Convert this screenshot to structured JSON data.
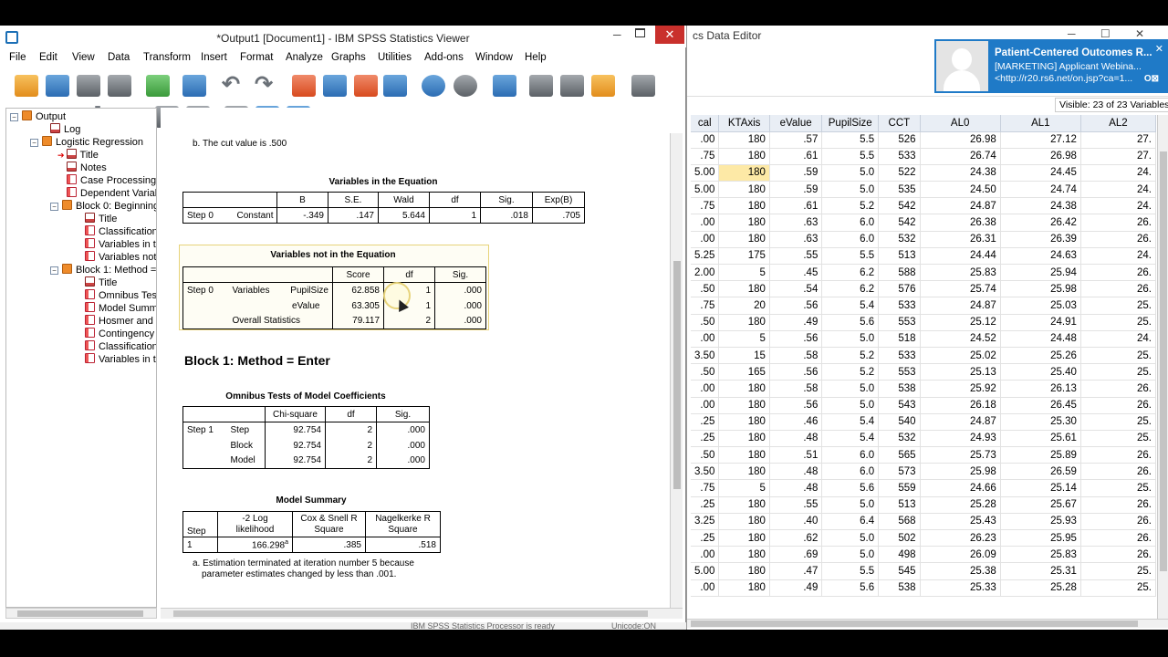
{
  "viewer": {
    "title": "*Output1 [Document1] - IBM SPSS Statistics Viewer",
    "close_label": "✕",
    "menu": [
      "File",
      "Edit",
      "View",
      "Data",
      "Transform",
      "Insert",
      "Format",
      "Analyze",
      "Graphs",
      "Utilities",
      "Add-ons",
      "Window",
      "Help"
    ],
    "status_text": "IBM SPSS Statistics Processor is ready",
    "status_right": "Unicode:ON"
  },
  "outline": {
    "items": [
      "Output",
      "Log",
      "Logistic Regression",
      "Title",
      "Notes",
      "Case Processing",
      "Dependent Variab",
      "Block 0: Beginning",
      "Title",
      "Classification",
      "Variables in th",
      "Variables not",
      "Block 1: Method =",
      "Title",
      "Omnibus Tes",
      "Model Summ",
      "Hosmer and",
      "Contingency",
      "Classification",
      "Variables in th"
    ]
  },
  "content": {
    "footnote_b": "b. The cut value is .500",
    "vie": {
      "caption": "Variables in the Equation",
      "headers": [
        "B",
        "S.E.",
        "Wald",
        "df",
        "Sig.",
        "Exp(B)"
      ],
      "step": "Step 0",
      "row_label": "Constant",
      "values": [
        "-.349",
        ".147",
        "5.644",
        "1",
        ".018",
        ".705"
      ]
    },
    "vnie": {
      "caption": "Variables not in the Equation",
      "headers": [
        "Score",
        "df",
        "Sig."
      ],
      "step": "Step 0",
      "group": "Variables",
      "rows": [
        {
          "label": "PupilSize",
          "score": "62.858",
          "df": "1",
          "sig": ".000"
        },
        {
          "label": "eValue",
          "score": "63.305",
          "df": "1",
          "sig": ".000"
        }
      ],
      "overall": {
        "label": "Overall Statistics",
        "score": "79.117",
        "df": "2",
        "sig": ".000"
      }
    },
    "block1_heading": "Block 1: Method = Enter",
    "omnibus": {
      "caption": "Omnibus Tests of Model Coefficients",
      "headers": [
        "Chi-square",
        "df",
        "Sig."
      ],
      "step": "Step 1",
      "rows": [
        {
          "label": "Step",
          "chi": "92.754",
          "df": "2",
          "sig": ".000"
        },
        {
          "label": "Block",
          "chi": "92.754",
          "df": "2",
          "sig": ".000"
        },
        {
          "label": "Model",
          "chi": "92.754",
          "df": "2",
          "sig": ".000"
        }
      ]
    },
    "model_summary": {
      "caption": "Model Summary",
      "h_step": "Step",
      "h_ll1": "-2 Log",
      "h_ll2": "likelihood",
      "h_cox1": "Cox & Snell R",
      "h_cox2": "Square",
      "h_nag1": "Nagelkerke R",
      "h_nag2": "Square",
      "step": "1",
      "ll": "166.298",
      "ll_sup": "a",
      "cox": ".385",
      "nag": ".518",
      "footnote1": "a. Estimation terminated at iteration number 5 because",
      "footnote2": "parameter estimates changed by less than .001."
    }
  },
  "data_editor": {
    "title": "cs Data Editor",
    "visible": "Visible: 23 of 23 Variables",
    "columns": [
      "cal",
      "KTAxis",
      "eValue",
      "PupilSize",
      "CCT",
      "AL0",
      "AL1",
      "AL2"
    ],
    "rows": [
      [
        ".00",
        "180",
        ".57",
        "5.5",
        "526",
        "26.98",
        "27.12",
        "27."
      ],
      [
        ".75",
        "180",
        ".61",
        "5.5",
        "533",
        "26.74",
        "26.98",
        "27."
      ],
      [
        "5.00",
        "180",
        ".59",
        "5.0",
        "522",
        "24.38",
        "24.45",
        "24."
      ],
      [
        "5.00",
        "180",
        ".59",
        "5.0",
        "535",
        "24.50",
        "24.74",
        "24."
      ],
      [
        ".75",
        "180",
        ".61",
        "5.2",
        "542",
        "24.87",
        "24.38",
        "24."
      ],
      [
        ".00",
        "180",
        ".63",
        "6.0",
        "542",
        "26.38",
        "26.42",
        "26."
      ],
      [
        ".00",
        "180",
        ".63",
        "6.0",
        "532",
        "26.31",
        "26.39",
        "26."
      ],
      [
        "5.25",
        "175",
        ".55",
        "5.5",
        "513",
        "24.44",
        "24.63",
        "24."
      ],
      [
        "2.00",
        "5",
        ".45",
        "6.2",
        "588",
        "25.83",
        "25.94",
        "26."
      ],
      [
        ".50",
        "180",
        ".54",
        "6.2",
        "576",
        "25.74",
        "25.98",
        "26."
      ],
      [
        ".75",
        "20",
        ".56",
        "5.4",
        "533",
        "24.87",
        "25.03",
        "25."
      ],
      [
        ".50",
        "180",
        ".49",
        "5.6",
        "553",
        "25.12",
        "24.91",
        "25."
      ],
      [
        ".00",
        "5",
        ".56",
        "5.0",
        "518",
        "24.52",
        "24.48",
        "24."
      ],
      [
        "3.50",
        "15",
        ".58",
        "5.2",
        "533",
        "25.02",
        "25.26",
        "25."
      ],
      [
        ".50",
        "165",
        ".56",
        "5.2",
        "553",
        "25.13",
        "25.40",
        "25."
      ],
      [
        ".00",
        "180",
        ".58",
        "5.0",
        "538",
        "25.92",
        "26.13",
        "26."
      ],
      [
        ".00",
        "180",
        ".56",
        "5.0",
        "543",
        "26.18",
        "26.45",
        "26."
      ],
      [
        ".25",
        "180",
        ".46",
        "5.4",
        "540",
        "24.87",
        "25.30",
        "25."
      ],
      [
        ".25",
        "180",
        ".48",
        "5.4",
        "532",
        "24.93",
        "25.61",
        "25."
      ],
      [
        ".50",
        "180",
        ".51",
        "6.0",
        "565",
        "25.73",
        "25.89",
        "26."
      ],
      [
        "3.50",
        "180",
        ".48",
        "6.0",
        "573",
        "25.98",
        "26.59",
        "26."
      ],
      [
        ".75",
        "5",
        ".48",
        "5.6",
        "559",
        "24.66",
        "25.14",
        "25."
      ],
      [
        ".25",
        "180",
        ".55",
        "5.0",
        "513",
        "25.28",
        "25.67",
        "26."
      ],
      [
        "3.25",
        "180",
        ".40",
        "6.4",
        "568",
        "25.43",
        "25.93",
        "26."
      ],
      [
        ".25",
        "180",
        ".62",
        "5.0",
        "502",
        "26.23",
        "25.95",
        "26."
      ],
      [
        ".00",
        "180",
        ".69",
        "5.0",
        "498",
        "26.09",
        "25.83",
        "26."
      ],
      [
        "5.00",
        "180",
        ".47",
        "5.5",
        "545",
        "25.38",
        "25.31",
        "25."
      ],
      [
        ".00",
        "180",
        ".49",
        "5.6",
        "538",
        "25.33",
        "25.28",
        "25."
      ]
    ]
  },
  "notification": {
    "title": "Patient-Centered Outcomes R...",
    "line1": "[MARKETING] Applicant Webina...",
    "line2": "<http://r20.rs6.net/on.jsp?ca=1...",
    "close": "✕",
    "badge": "O⊠"
  }
}
